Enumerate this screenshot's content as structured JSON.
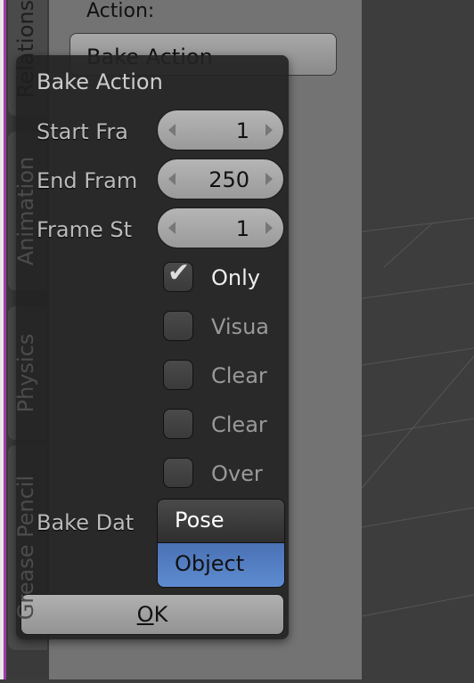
{
  "tabs": [
    "Relations",
    "Animation",
    "Physics",
    "Grease Pencil"
  ],
  "panel": {
    "action_label": "Action:",
    "action_value": "Bake Action"
  },
  "dialog": {
    "title": "Bake Action",
    "fields": [
      {
        "label": "Start Fra",
        "value": "1"
      },
      {
        "label": "End Fram",
        "value": "250"
      },
      {
        "label": "Frame St",
        "value": "1"
      }
    ],
    "checkboxes": [
      {
        "label": "Only",
        "checked": true
      },
      {
        "label": "Visua",
        "checked": false
      },
      {
        "label": "Clear",
        "checked": false
      },
      {
        "label": "Clear",
        "checked": false
      },
      {
        "label": "Over",
        "checked": false
      }
    ],
    "bake_data_label": "Bake Dat",
    "bake_data_options": [
      "Pose",
      "Object"
    ],
    "bake_data_highlighted": "Object",
    "ok_first": "O",
    "ok_rest": "K"
  },
  "colors": {
    "highlight": "#5680c2",
    "accent_border": "#a03aa8"
  }
}
